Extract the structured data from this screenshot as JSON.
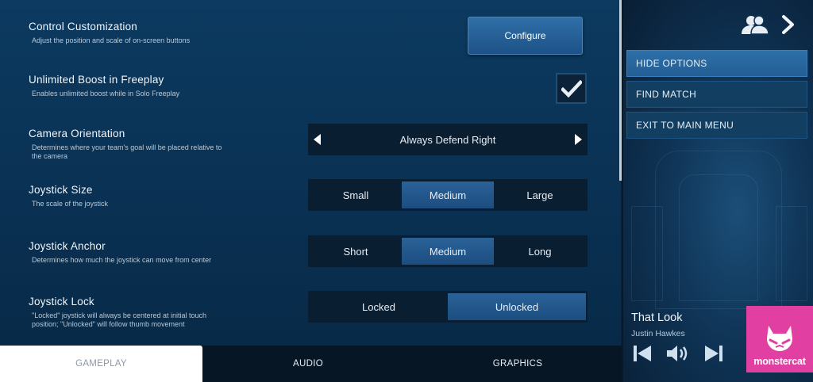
{
  "settings": [
    {
      "title": "Control Customization",
      "desc": "Adjust the position and scale of on-screen buttons"
    },
    {
      "title": "Unlimited Boost in Freeplay",
      "desc": "Enables unlimited boost while in Solo Freeplay"
    },
    {
      "title": "Camera Orientation",
      "desc": "Determines where your team's goal will be placed relative to the camera"
    },
    {
      "title": "Joystick Size",
      "desc": "The scale of the joystick"
    },
    {
      "title": "Joystick Anchor",
      "desc": "Determines how much the joystick can move from center"
    },
    {
      "title": "Joystick Lock",
      "desc": "\"Locked\" joystick will always be centered at initial touch position; \"Unlocked\" will follow thumb movement"
    }
  ],
  "configure_label": "Configure",
  "unlimited_boost_checked": true,
  "camera_orientation_value": "Always Defend Right",
  "joystick_size": {
    "options": [
      "Small",
      "Medium",
      "Large"
    ],
    "selected": "Medium"
  },
  "joystick_anchor": {
    "options": [
      "Short",
      "Medium",
      "Long"
    ],
    "selected": "Medium"
  },
  "joystick_lock": {
    "options": [
      "Locked",
      "Unlocked"
    ],
    "selected": "Unlocked"
  },
  "tabs": [
    {
      "label": "GAMEPLAY",
      "active": true
    },
    {
      "label": "AUDIO",
      "active": false
    },
    {
      "label": "GRAPHICS",
      "active": false
    }
  ],
  "menu": [
    {
      "label": "HIDE OPTIONS",
      "active": true
    },
    {
      "label": "FIND MATCH",
      "active": false
    },
    {
      "label": "EXIT TO MAIN MENU",
      "active": false
    }
  ],
  "now_playing": {
    "title": "That Look",
    "artist": "Justin Hawkes",
    "album_brand": "monstercat"
  },
  "icons": [
    "party-icon",
    "chevron-right-icon",
    "check-icon",
    "arrow-left-icon",
    "arrow-right-icon",
    "previous-track-icon",
    "volume-icon",
    "next-track-icon"
  ],
  "colors": {
    "accent": "#2a6298",
    "album": "#e23fa3"
  }
}
